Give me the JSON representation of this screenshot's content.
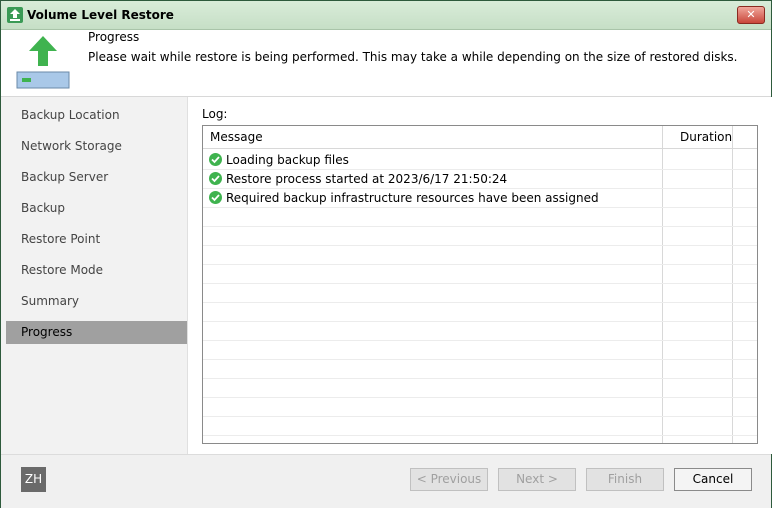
{
  "window": {
    "title": "Volume Level Restore",
    "close_glyph": "✕"
  },
  "header": {
    "title": "Progress",
    "description": "Please wait while restore is being performed. This may take a while depending on the size of restored disks.",
    "icon": "upload-restore-icon"
  },
  "sidebar": {
    "items": [
      {
        "label": "Backup Location",
        "active": false
      },
      {
        "label": "Network Storage",
        "active": false
      },
      {
        "label": "Backup Server",
        "active": false
      },
      {
        "label": "Backup",
        "active": false
      },
      {
        "label": "Restore Point",
        "active": false
      },
      {
        "label": "Restore Mode",
        "active": false
      },
      {
        "label": "Summary",
        "active": false
      },
      {
        "label": "Progress",
        "active": true
      }
    ]
  },
  "log": {
    "label": "Log:",
    "columns": {
      "message": "Message",
      "duration": "Duration"
    },
    "rows": [
      {
        "message": "Loading backup files",
        "duration": "",
        "status": "success"
      },
      {
        "message": "Restore process started at 2023/6/17 21:50:24",
        "duration": "",
        "status": "success"
      },
      {
        "message": "Required backup infrastructure resources have been assigned",
        "duration": "",
        "status": "success"
      }
    ]
  },
  "footer": {
    "avatar": "ZH",
    "buttons": {
      "previous": "< Previous",
      "next": "Next >",
      "finish": "Finish",
      "cancel": "Cancel"
    }
  },
  "colors": {
    "accent": "#3a9a55",
    "success": "#3fb34f",
    "active_nav": "#a0a0a0"
  }
}
